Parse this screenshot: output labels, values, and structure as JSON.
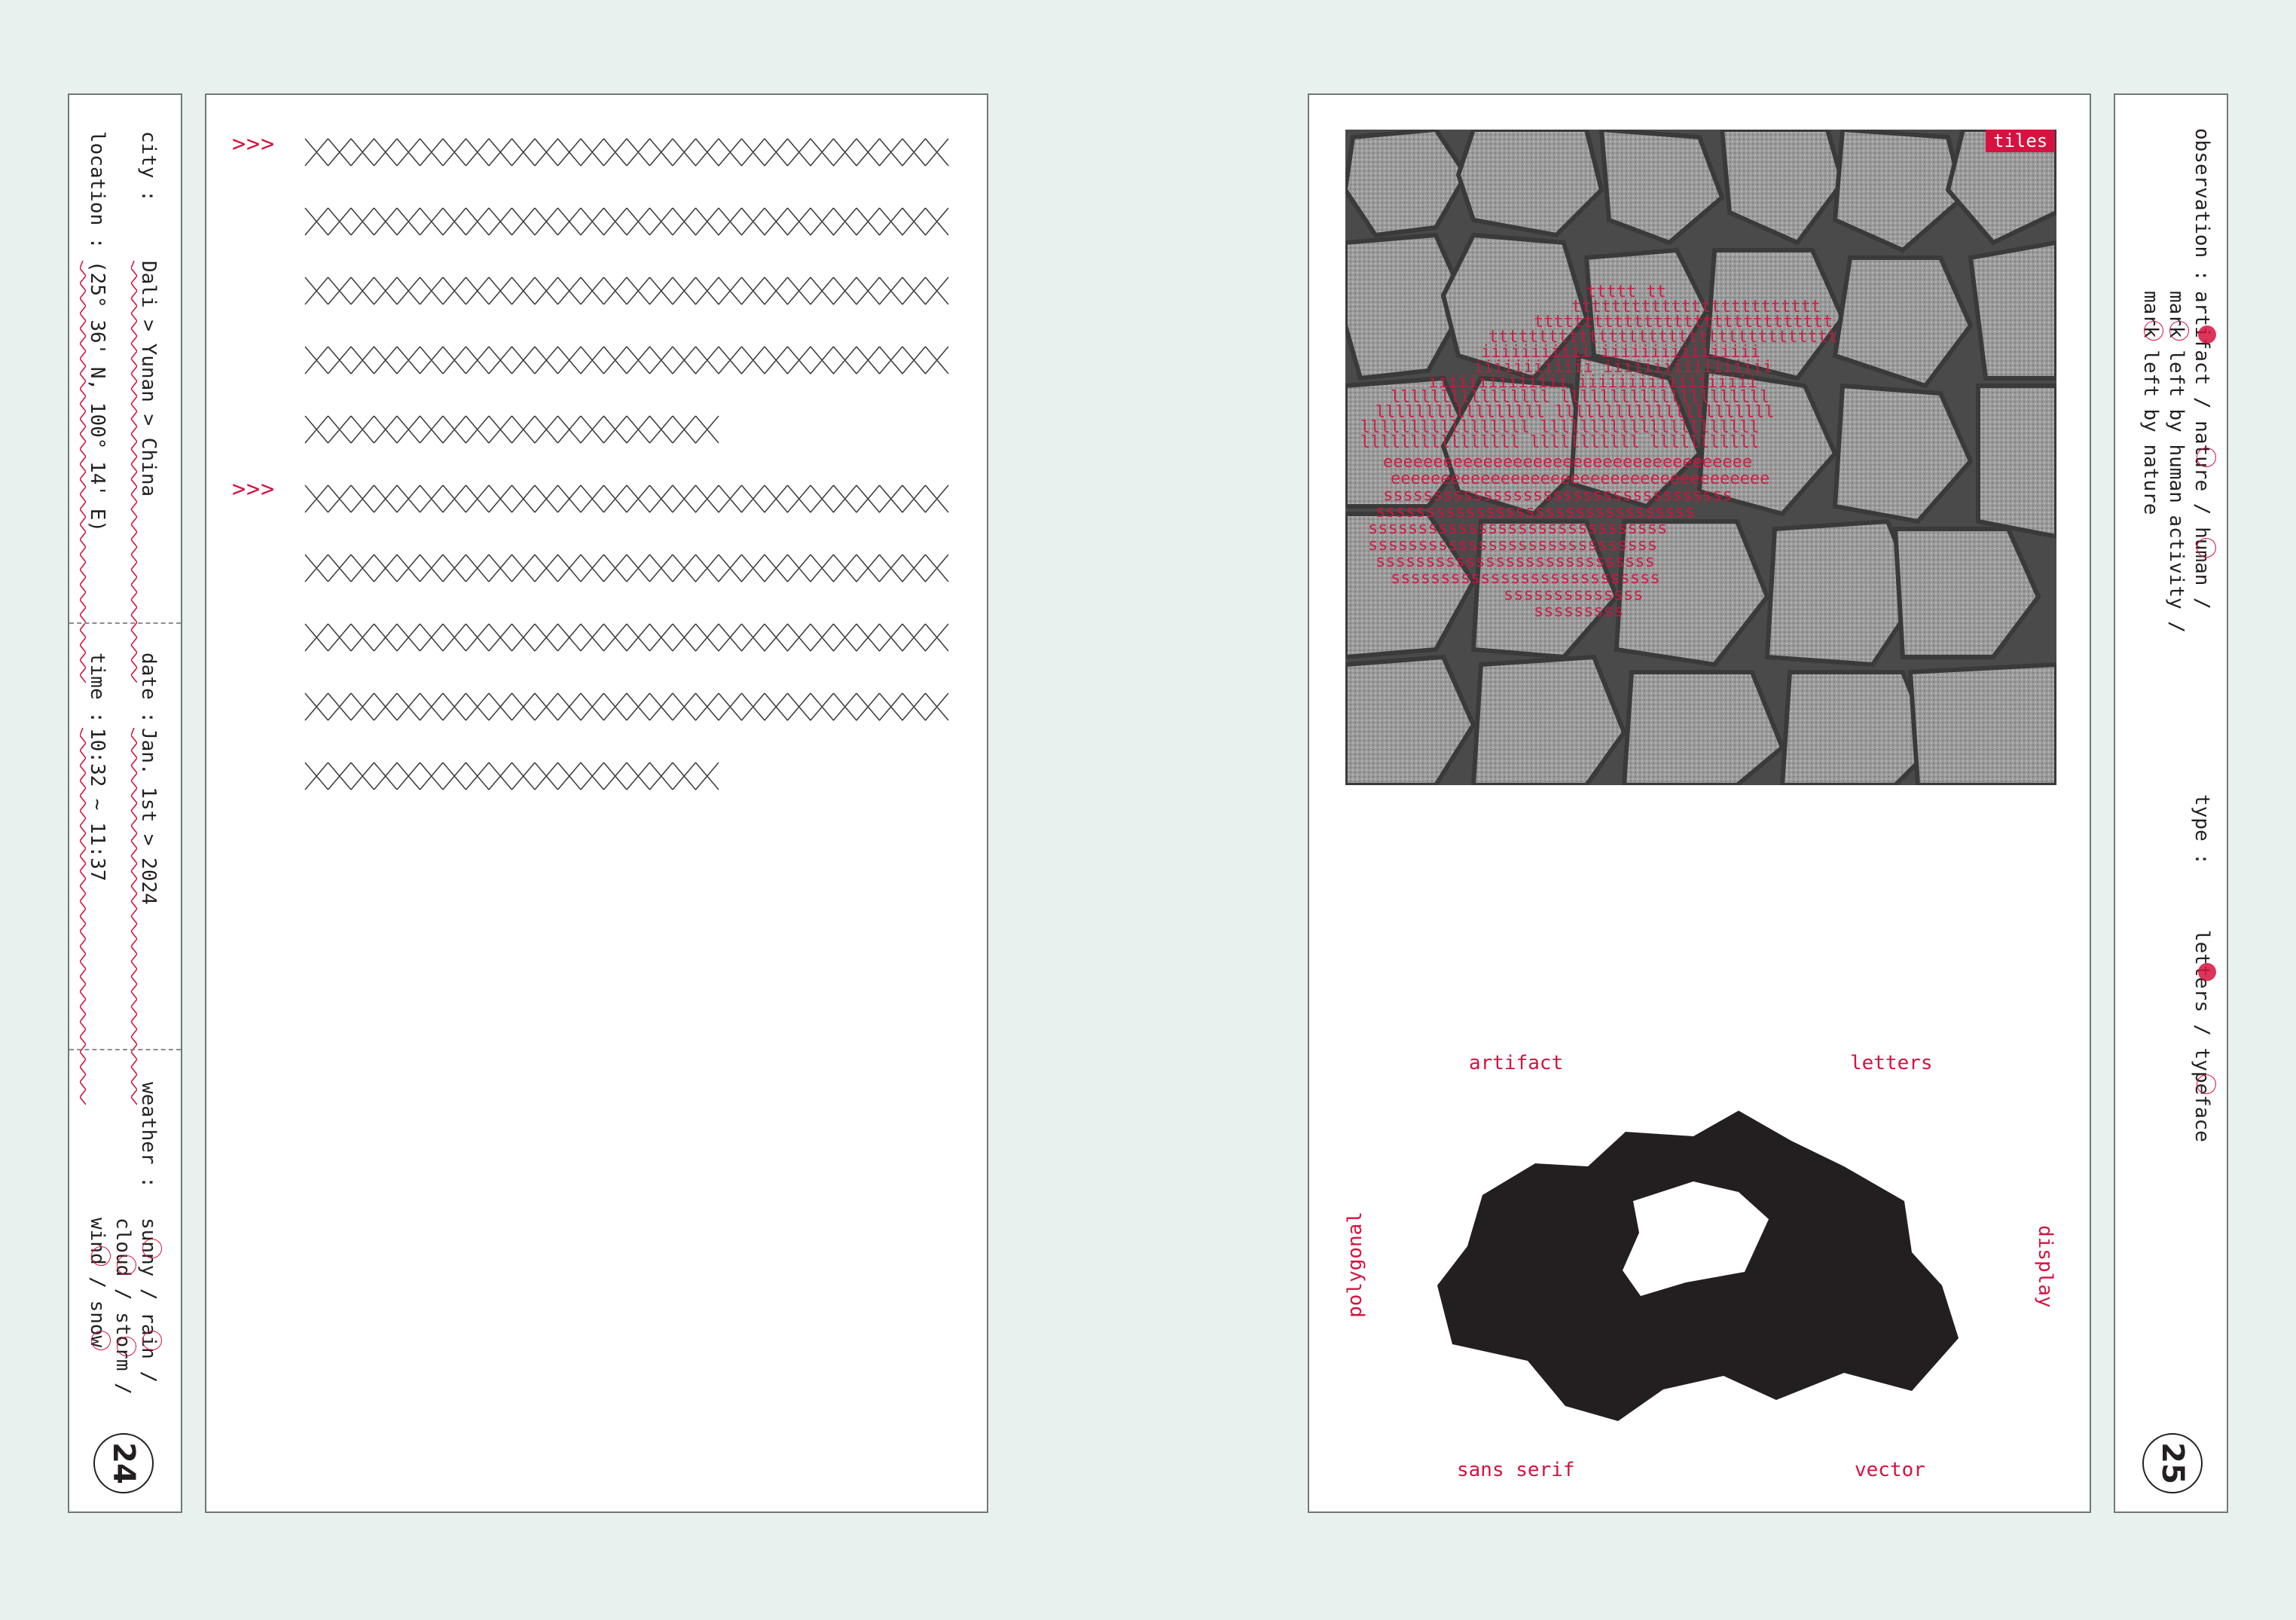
{
  "left_page": {
    "sidebar": {
      "city_label": "city :",
      "city_value": "Dali > Yunan > China",
      "location_label": "location :",
      "location_value": "(25° 36' N, 100° 14' E)",
      "date_label": "date :",
      "date_value": "Jan. 1st > 2024",
      "time_label": "time :",
      "time_value": "10:32 ~ 11:37",
      "weather_label": "weather :",
      "weather_line1": "sunny / rain /",
      "weather_line2": "cloud / storm /",
      "weather_line3": "wind / snow",
      "page_number": "24"
    },
    "body": {
      "arrow_1": ">>>",
      "arrow_2": ">>>"
    }
  },
  "right_page": {
    "photo_badge": "tiles",
    "diagram_labels": {
      "top_left": "artifact",
      "top_right": "letters",
      "left": "polygonal",
      "right": "display",
      "bottom_left": "sans serif",
      "bottom_right": "vector"
    },
    "sidebar": {
      "observation_label": "observation :",
      "observation_line1": "artifact / nature / human /",
      "observation_line2": "mark left by human activity /",
      "observation_line3": "mark left by nature",
      "type_label": "type :",
      "type_value": "letters / typeface",
      "page_number": "25"
    }
  },
  "colors": {
    "accent": "#d6123f",
    "background": "#e9f1ee",
    "ink": "#231f20"
  }
}
